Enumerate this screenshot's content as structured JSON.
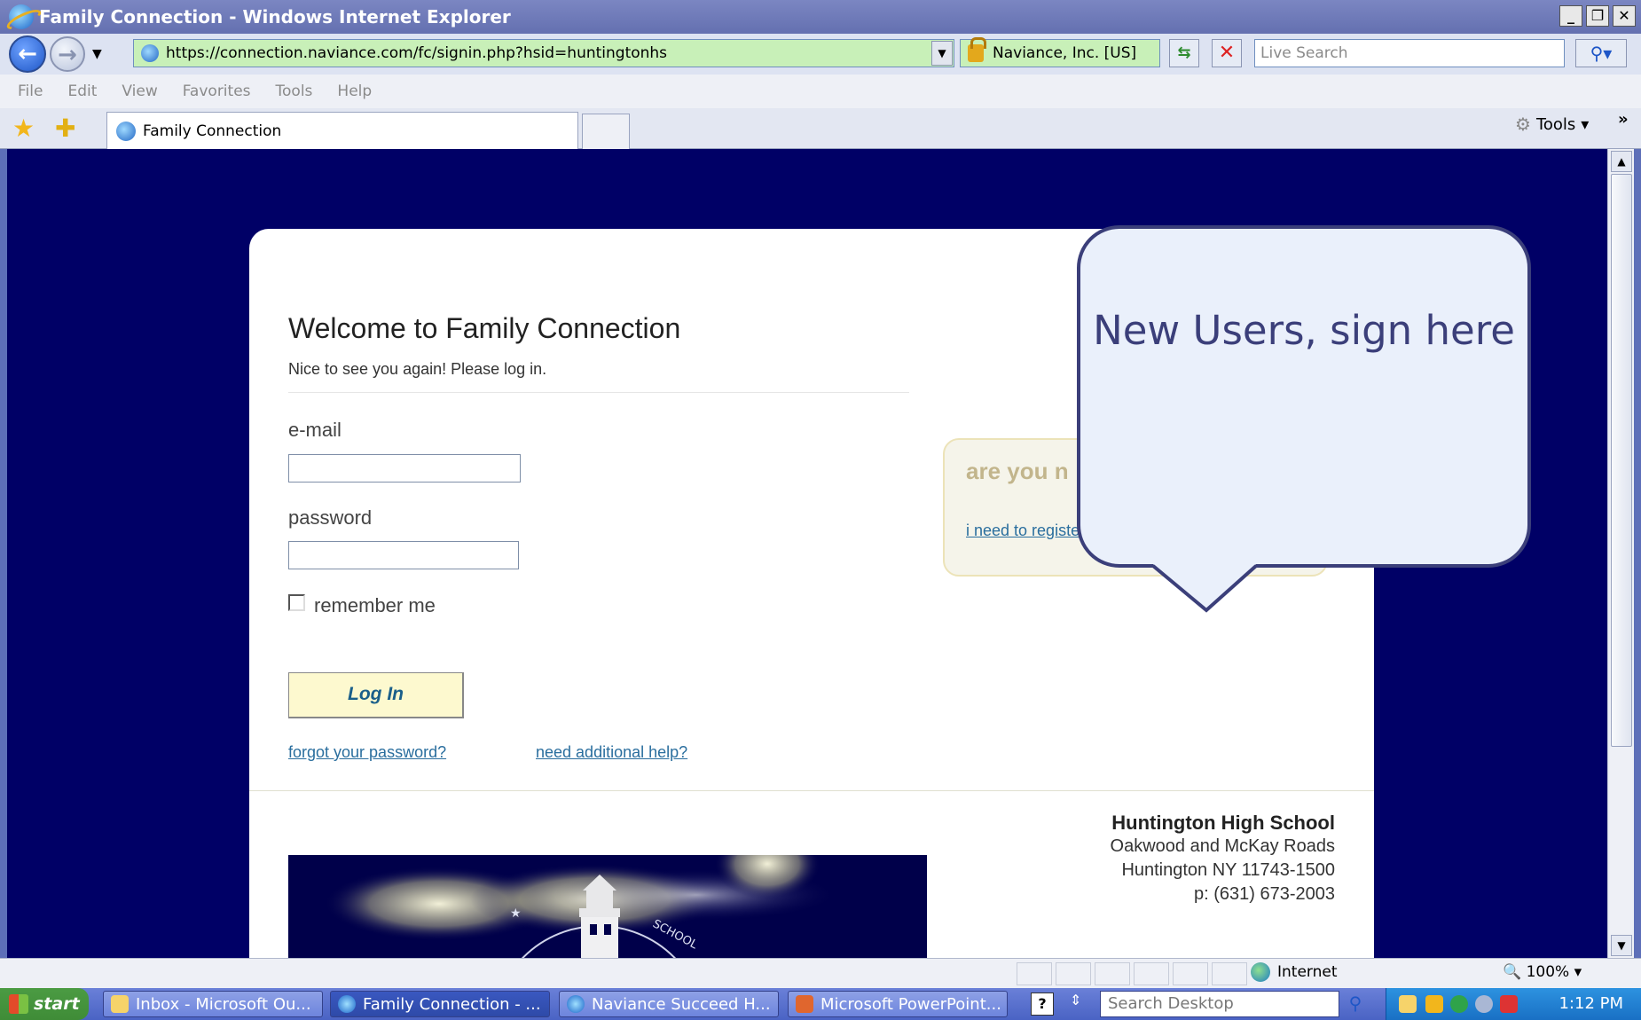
{
  "window": {
    "title": "Family Connection - Windows Internet Explorer",
    "controls": [
      "_",
      "❐",
      "✕"
    ]
  },
  "addressbar": {
    "url": "https://connection.naviance.com/fc/signin.php?hsid=huntingtonhs",
    "cert": "Naviance, Inc. [US]",
    "search_placeholder": "Live Search"
  },
  "menu": [
    "File",
    "Edit",
    "View",
    "Favorites",
    "Tools",
    "Help"
  ],
  "tabs": {
    "active_label": "Family Connection",
    "tools_label": "Tools"
  },
  "page": {
    "welcome_title": "Welcome to Family Connection",
    "welcome_sub": "Nice to see you again! Please log in.",
    "email_label": "e-mail",
    "password_label": "password",
    "remember_label": "remember me",
    "login_label": "Log In",
    "forgot_link": "forgot your password?",
    "help_link": "need additional help?",
    "register_title": "are you n",
    "register_link": "i need to register >"
  },
  "school": {
    "name": "Huntington High School",
    "address1": "Oakwood and McKay Roads",
    "address2": "Huntington NY 11743-1500",
    "phone": "p: (631) 673-2003"
  },
  "callout": {
    "text": "New Users, sign here"
  },
  "statusbar": {
    "zone": "Internet",
    "zoom": "100%"
  },
  "taskbar": {
    "start_label": "start",
    "items": [
      "Inbox - Microsoft Ou...",
      "Family Connection - ...",
      "Naviance Succeed H...",
      "Microsoft PowerPoint..."
    ],
    "desktop_search_placeholder": "Search Desktop",
    "clock": "1:12 PM"
  }
}
